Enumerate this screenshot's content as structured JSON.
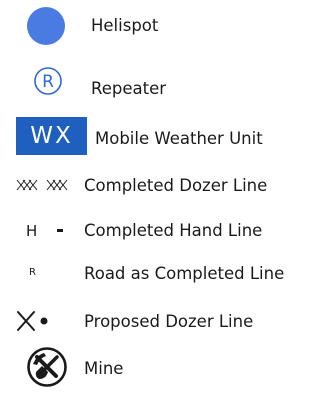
{
  "colors": {
    "helispot": "#4a7be3",
    "repeater": "#2f66d6",
    "weather_box": "#1f5fbf",
    "weather_text": "#ffffff",
    "ink": "#1a1a1a"
  },
  "legend": {
    "items": [
      {
        "label": "Helispot",
        "icon": "blue-filled-circle-icon"
      },
      {
        "label": "Repeater",
        "icon": "circled-r-icon",
        "symbol_text": "R"
      },
      {
        "label": "Mobile Weather Unit",
        "icon": "wx-box-icon",
        "symbol_text": "WX"
      },
      {
        "label": "Completed Dozer Line",
        "icon": "double-cross-hatch-icon"
      },
      {
        "label": "Completed Hand Line",
        "icon": "h-dash-icon",
        "symbol_text": "H"
      },
      {
        "label": "Road as Completed Line",
        "icon": "small-r-icon",
        "symbol_text": "R"
      },
      {
        "label": "Proposed Dozer Line",
        "icon": "x-dot-icon"
      },
      {
        "label": "Mine",
        "icon": "crossed-pick-shovel-icon"
      }
    ]
  }
}
